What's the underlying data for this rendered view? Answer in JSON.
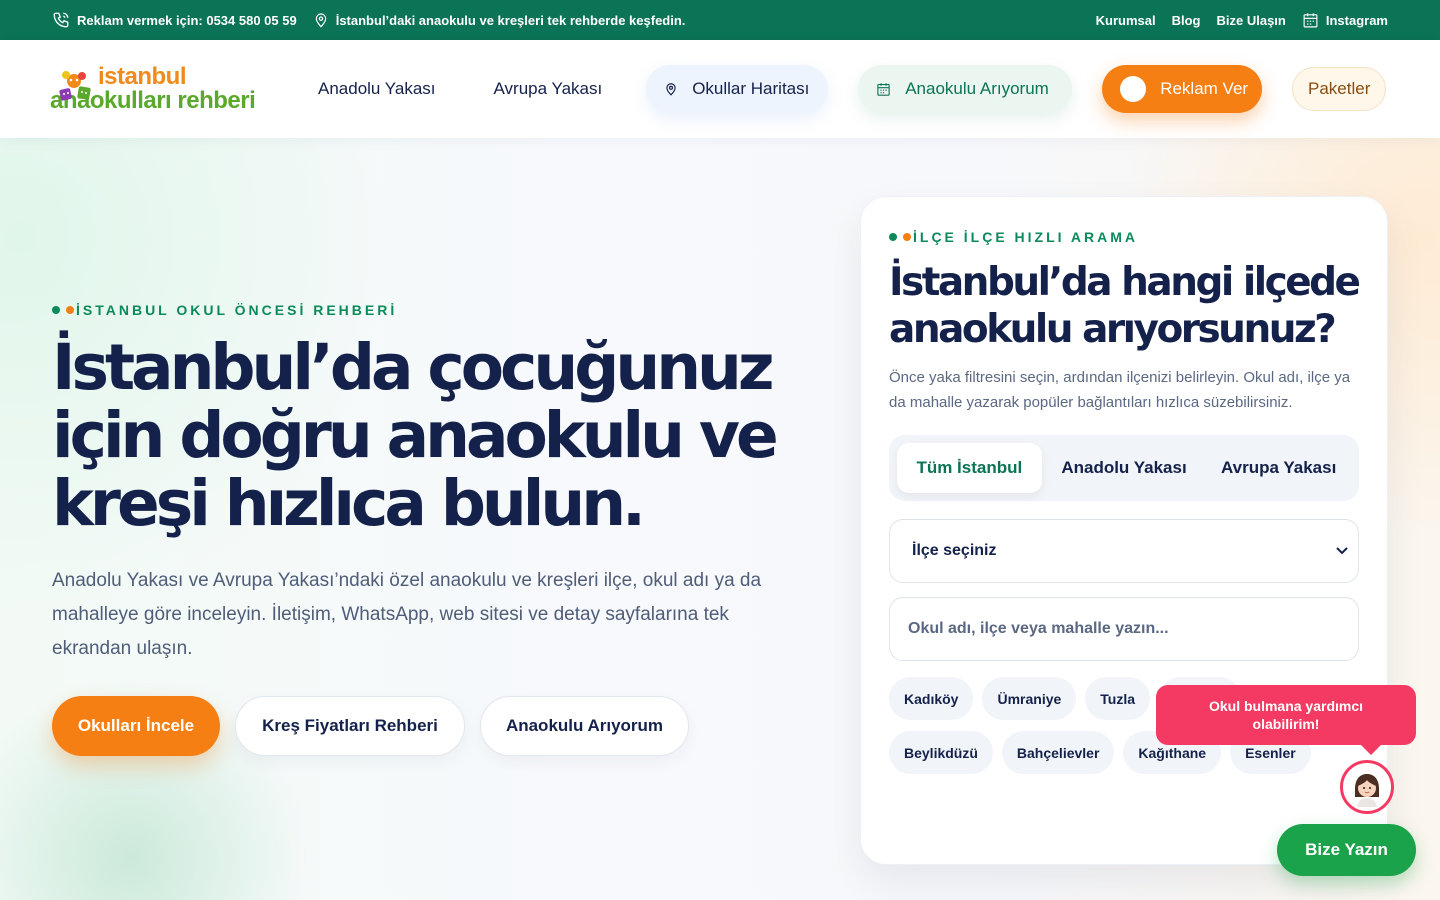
{
  "topbar": {
    "phone": "Reklam vermek için: 0534 580 05 59",
    "tagline": "İstanbul’daki anaokulu ve kreşleri tek rehberde keşfedin.",
    "links": [
      "Kurumsal",
      "Blog",
      "Bize Ulaşın"
    ],
    "instagram": "Instagram"
  },
  "logo": {
    "line1": "istanbul",
    "line2": "anaokulları rehberi"
  },
  "nav": {
    "anadolu": "Anadolu Yakası",
    "avrupa": "Avrupa Yakası",
    "map": "Okullar Haritası",
    "find": "Anaokulu Arıyorum",
    "ad": "Reklam Ver",
    "packages": "Paketler"
  },
  "hero": {
    "eyebrow": "İSTANBUL OKUL ÖNCESİ REHBERİ",
    "title_lines": [
      "İstanbul’da çocuğunuz",
      "için doğru anaokulu ve",
      "kreşi hızlıca bulun."
    ],
    "lead": "Anadolu Yakası ve Avrupa Yakası’ndaki özel anaokulu ve kreşleri ilçe, okul adı ya da mahalleye göre inceleyin. İletişim, WhatsApp, web sitesi ve detay sayfalarına tek ekrandan ulaşın.",
    "buttons": {
      "primary": "Okulları İncele",
      "prices": "Kreş Fiyatları Rehberi",
      "find": "Anaokulu Arıyorum"
    }
  },
  "search": {
    "eyebrow": "İLÇE İLÇE HIZLI ARAMA",
    "title_lines": [
      "İstanbul’da hangi ilçede",
      "anaokulu arıyorsunuz?"
    ],
    "description": "Önce yaka filtresini seçin, ardından ilçenizi belirleyin. Okul adı, ilçe ya da mahalle yazarak popüler bağlantıları hızlıca süzebilirsiniz.",
    "tabs": [
      "Tüm İstanbul",
      "Anadolu Yakası",
      "Avrupa Yakası"
    ],
    "active_tab": "Tüm İstanbul",
    "select_value": "İlçe seçiniz",
    "input_placeholder": "Okul adı, ilçe veya mahalle yazın...",
    "input_value": "",
    "districts": [
      "Kadıköy",
      "Ümraniye",
      "Tuzla",
      "Maltepe",
      "Beylikdüzü",
      "Bahçelievler",
      "Kağıthane",
      "Esenler"
    ]
  },
  "chat": {
    "bubble": "Okul bulmana yardımcı olabilirim!",
    "button": "Bize Yazın"
  },
  "colors": {
    "primary_green": "#0b7356",
    "accent_orange": "#f67f13",
    "navy": "#14214a",
    "chat_pink": "#f43a62",
    "chat_green": "#1aa34a"
  }
}
